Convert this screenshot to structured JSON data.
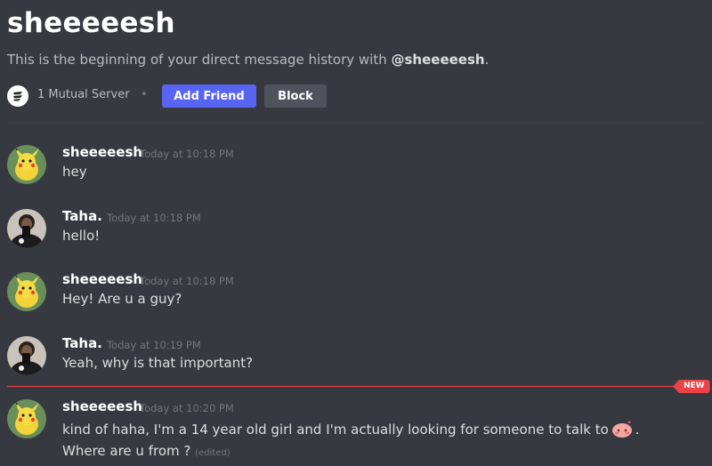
{
  "header": {
    "title": "sheeeeesh",
    "intro_prefix": "This is the beginning of your direct message history with ",
    "intro_mention": "@sheeeeesh",
    "intro_suffix": ".",
    "mutual_servers": "1 Mutual Server",
    "separator": "•",
    "add_friend_label": "Add Friend",
    "block_label": "Block"
  },
  "messages": [
    {
      "author": "sheeeeesh",
      "timestamp": "Today at 10:18 PM",
      "text": "hey",
      "avatar": "pikachu-avatar"
    },
    {
      "author": "Taha.",
      "timestamp": "Today at 10:18 PM",
      "text": "hello!",
      "avatar": "user-avatar"
    },
    {
      "author": "sheeeeesh",
      "timestamp": "Today at 10:18 PM",
      "text": "Hey! Are u a guy?",
      "avatar": "pikachu-avatar"
    },
    {
      "author": "Taha.",
      "timestamp": "Today at 10:19 PM",
      "text": "Yeah, why is that important?",
      "avatar": "user-avatar"
    },
    {
      "author": "sheeeeesh",
      "timestamp": "Today at 10:20 PM",
      "text_part1": "kind of haha, I'm a 14 year old girl and I'm actually looking for someone to talk to",
      "emoji": "blush-emoji",
      "text_part2": ". Where are u from ?",
      "edited": "(edited)",
      "avatar": "pikachu-avatar"
    }
  ],
  "new_divider": {
    "label": "NEW"
  },
  "colors": {
    "background": "#36393f",
    "accent": "#5865f2",
    "danger": "#ed4245",
    "secondary_button": "#4f545c"
  }
}
